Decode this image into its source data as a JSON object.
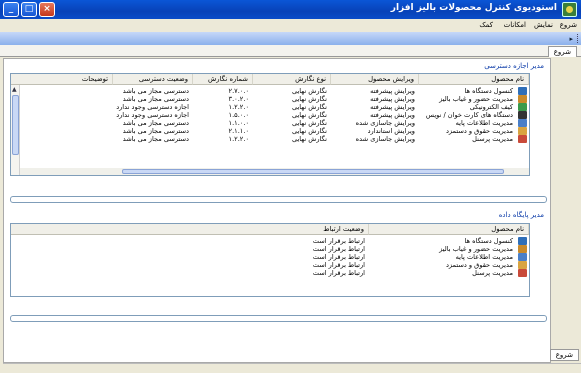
{
  "window": {
    "title": "استودیوی کنترل محصولات بالیز افزار",
    "buttons": {
      "minimize": "_",
      "maximize": "□",
      "close": "×"
    }
  },
  "menu": [
    "شروع",
    "نمایش",
    "امکانات",
    "کمک"
  ],
  "tabs": {
    "top": "شروع",
    "bottom": "شروع"
  },
  "permissions": {
    "section_title": "مدیر اجازه دسترسی",
    "columns": [
      "نام محصول",
      "ویرایش محصول",
      "نوع نگارش",
      "شماره نگارش",
      "وضعیت دسترسی",
      "توضیحات"
    ],
    "rows": [
      {
        "icon": "monitor-icon",
        "name": "کنسول دستگاه ها",
        "edition": "ویرایش پیشرفته",
        "type": "نگارش نهایی",
        "version": "۲.۷.۰.۰",
        "status": "دسترسی مجاز می باشد",
        "notes": ""
      },
      {
        "icon": "attendance-icon",
        "name": "مدیریت حضور و غیاب بالیز",
        "edition": "ویرایش پیشرفته",
        "type": "نگارش نهایی",
        "version": "۳.۰.۲.۰",
        "status": "دسترسی مجاز می باشد",
        "notes": ""
      },
      {
        "icon": "wallet-icon",
        "name": "کیف الکترونیکی",
        "edition": "ویرایش پیشرفته",
        "type": "نگارش نهایی",
        "version": "۱.۲.۲.۰",
        "status": "اجازه دسترسی وجود ندارد",
        "notes": ""
      },
      {
        "icon": "card-reader-icon",
        "name": "دستگاه های کارت خوان / نویس",
        "edition": "ویرایش پیشرفته",
        "type": "نگارش نهایی",
        "version": "۱.۵.۰.۰",
        "status": "اجازه دسترسی وجود ندارد",
        "notes": ""
      },
      {
        "icon": "database-icon",
        "name": "مدیریت اطلاعات پایه",
        "edition": "ویرایش جاسازی شده",
        "type": "نگارش نهایی",
        "version": "۱.۱.۰.۰",
        "status": "دسترسی مجاز می باشد",
        "notes": ""
      },
      {
        "icon": "salary-icon",
        "name": "مدیریت حقوق و دستمزد",
        "edition": "ویرایش استاندارد",
        "type": "نگارش نهایی",
        "version": "۲.۱.۱.۰",
        "status": "دسترسی مجاز می باشد",
        "notes": ""
      },
      {
        "icon": "personnel-icon",
        "name": "مدیریت پرسنل",
        "edition": "ویرایش جاسازی شده",
        "type": "نگارش نهایی",
        "version": "۱.۲.۲.۰",
        "status": "دسترسی مجاز می باشد",
        "notes": ""
      }
    ]
  },
  "database": {
    "section_title": "مدیر پایگاه داده",
    "columns": [
      "نام محصول",
      "وضعیت ارتباط"
    ],
    "rows": [
      {
        "icon": "monitor-icon",
        "name": "کنسول دستگاه ها",
        "status": "ارتباط برقرار است"
      },
      {
        "icon": "attendance-icon",
        "name": "مدیریت حضور و غیاب بالیز",
        "status": "ارتباط برقرار است"
      },
      {
        "icon": "database-icon",
        "name": "مدیریت اطلاعات پایه",
        "status": "ارتباط برقرار است"
      },
      {
        "icon": "salary-icon",
        "name": "مدیریت حقوق و دستمزد",
        "status": "ارتباط برقرار است"
      },
      {
        "icon": "personnel-icon",
        "name": "مدیریت پرسنل",
        "status": "ارتباط برقرار است"
      }
    ]
  },
  "icon_colors": {
    "monitor-icon": "#2f6fb8",
    "attendance-icon": "#c98a2a",
    "wallet-icon": "#3a9a4a",
    "card-reader-icon": "#333333",
    "database-icon": "#4a7fc8",
    "salary-icon": "#d9a441",
    "personnel-icon": "#c94a3a"
  }
}
